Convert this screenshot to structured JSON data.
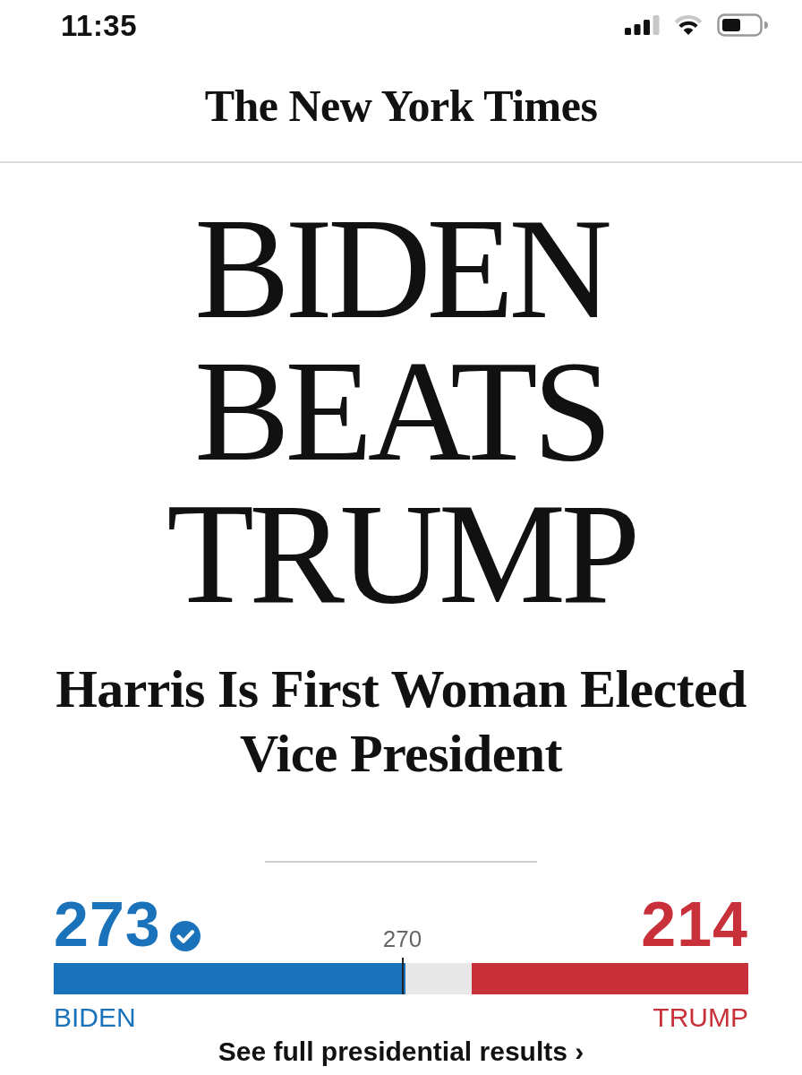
{
  "status_bar": {
    "time": "11:35"
  },
  "masthead": {
    "logo": "The New York Times"
  },
  "headline": "BIDEN BEATS TRUMP",
  "subheadline": "Harris Is First Woman Elected Vice President",
  "results": {
    "candidates": [
      {
        "name": "BIDEN",
        "votes": "273",
        "color": "#1a73ba",
        "winner": true,
        "level": 0.507
      },
      {
        "name": "TRUMP",
        "votes": "214",
        "color": "#c8313a",
        "winner": false,
        "level": 0.398
      }
    ],
    "threshold": {
      "label": "270",
      "level": 0.502
    },
    "link": "See full presidential results ›"
  }
}
